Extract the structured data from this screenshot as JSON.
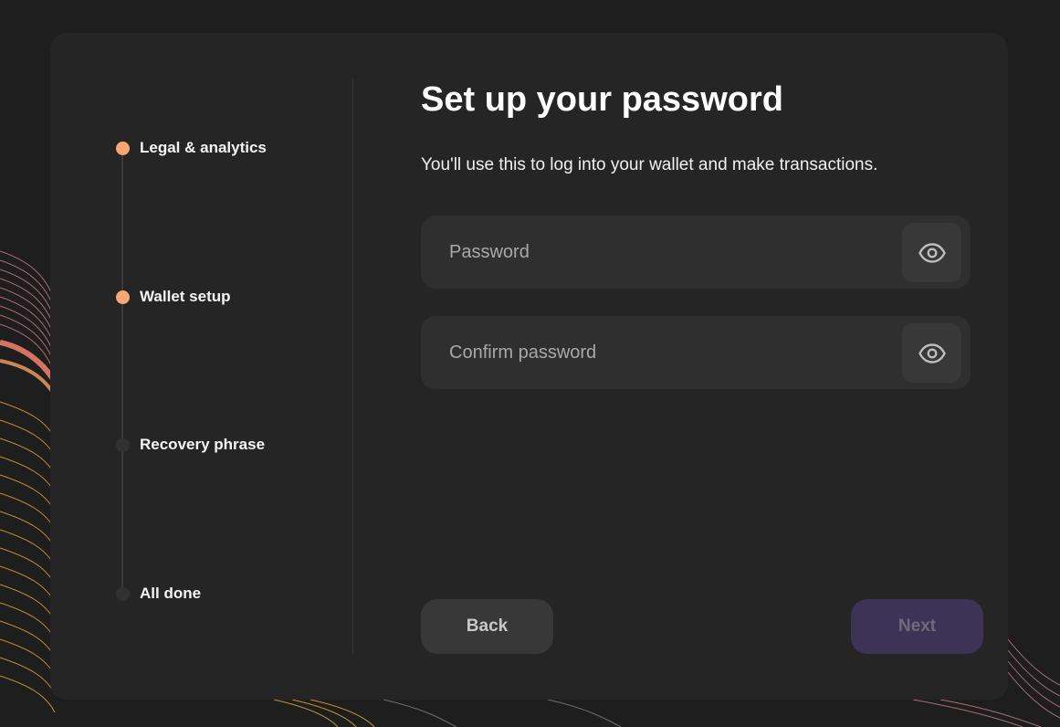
{
  "steps": [
    {
      "label": "Legal & analytics",
      "status": "done"
    },
    {
      "label": "Wallet setup",
      "status": "current"
    },
    {
      "label": "Recovery phrase",
      "status": "pending"
    },
    {
      "label": "All done",
      "status": "pending"
    }
  ],
  "page": {
    "title": "Set up your password",
    "subtitle": "You'll use this to log into your wallet and make transactions."
  },
  "form": {
    "password": {
      "placeholder": "Password",
      "value": "",
      "toggle_icon": "eye-icon"
    },
    "confirm_password": {
      "placeholder": "Confirm password",
      "value": "",
      "toggle_icon": "eye-icon"
    }
  },
  "buttons": {
    "back_label": "Back",
    "next_label": "Next",
    "next_disabled": true
  },
  "colors": {
    "accent_dot": "#f8a774",
    "next_button_bg": "#3c3357",
    "card_bg": "#252525",
    "page_bg": "#1e1e1e"
  }
}
